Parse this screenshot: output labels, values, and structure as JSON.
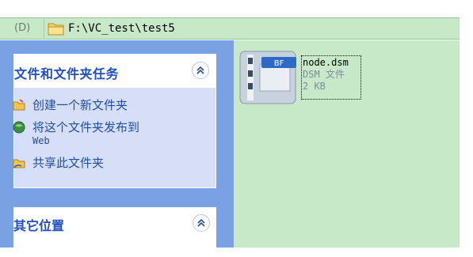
{
  "address": {
    "label": "(D)",
    "path": "F:\\VC_test\\test5"
  },
  "task_panel": {
    "title": "文件和文件夹任务",
    "items": [
      {
        "label": "创建一个新文件夹",
        "icon": "new-folder-icon"
      },
      {
        "label": "将这个文件夹发布到",
        "sub": "Web",
        "icon": "publish-web-icon"
      },
      {
        "label": "共享此文件夹",
        "icon": "share-folder-icon"
      }
    ]
  },
  "other_panel": {
    "title": "其它位置"
  },
  "file": {
    "name": "node.dsm",
    "type": "DSM 文件",
    "size": "2 KB",
    "badge": "BF",
    "icon": "dsm-file-icon"
  },
  "colors": {
    "sidebar": "#7aa1e3",
    "content_bg": "#c7e9c7",
    "panel_title": "#214fbf",
    "link_text": "#1f4ea6"
  }
}
